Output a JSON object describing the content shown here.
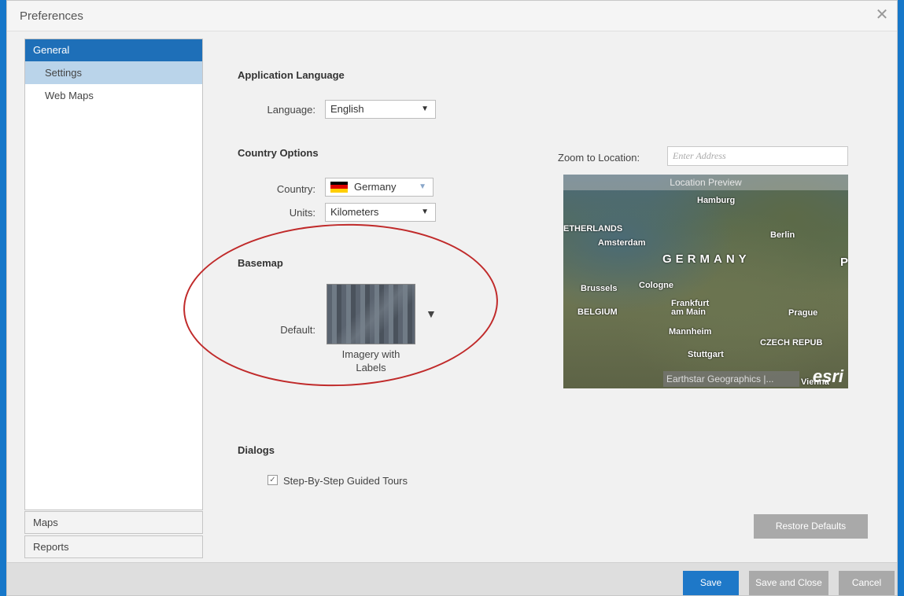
{
  "window": {
    "title": "Preferences",
    "close_symbol": "✕"
  },
  "sidebar": {
    "header": "General",
    "items": [
      {
        "label": "Settings",
        "selected": true
      },
      {
        "label": "Web Maps",
        "selected": false
      }
    ],
    "bottom_items": [
      "Maps",
      "Reports"
    ]
  },
  "language": {
    "section_title": "Application Language",
    "label": "Language:",
    "value": "English"
  },
  "country": {
    "section_title": "Country Options",
    "country_label": "Country:",
    "country_value": "Germany",
    "units_label": "Units:",
    "units_value": "Kilometers"
  },
  "basemap": {
    "section_title": "Basemap",
    "label": "Default:",
    "caption_line1": "Imagery with",
    "caption_line2": "Labels"
  },
  "location": {
    "label": "Zoom to Location:",
    "placeholder": "Enter Address",
    "preview_title": "Location Preview",
    "map_labels": {
      "hamburg": "Hamburg",
      "netherlands": "ETHERLANDS",
      "amsterdam": "Amsterdam",
      "berlin": "Berlin",
      "germany": "GERMANY",
      "brussels": "Brussels",
      "cologne": "Cologne",
      "frankfurt1": "Frankfurt",
      "frankfurt2": "am Main",
      "belgium": "BELGIUM",
      "prague": "Prague",
      "mannheim": "Mannheim",
      "czech": "CZECH REPUB",
      "stuttgart": "Stuttgart",
      "vienna": "Vienna",
      "p_edge": "P"
    },
    "attribution": "Earthstar Geographics |...",
    "logo": "esri"
  },
  "dialogs": {
    "section_title": "Dialogs",
    "tours_label": "Step-By-Step Guided Tours",
    "tours_checked": true
  },
  "buttons": {
    "restore": "Restore Defaults",
    "save": "Save",
    "save_close": "Save and Close",
    "cancel": "Cancel"
  },
  "colors": {
    "accent": "#1e78c8",
    "highlight": "#bad4ea",
    "annotation": "#c02a2a"
  }
}
